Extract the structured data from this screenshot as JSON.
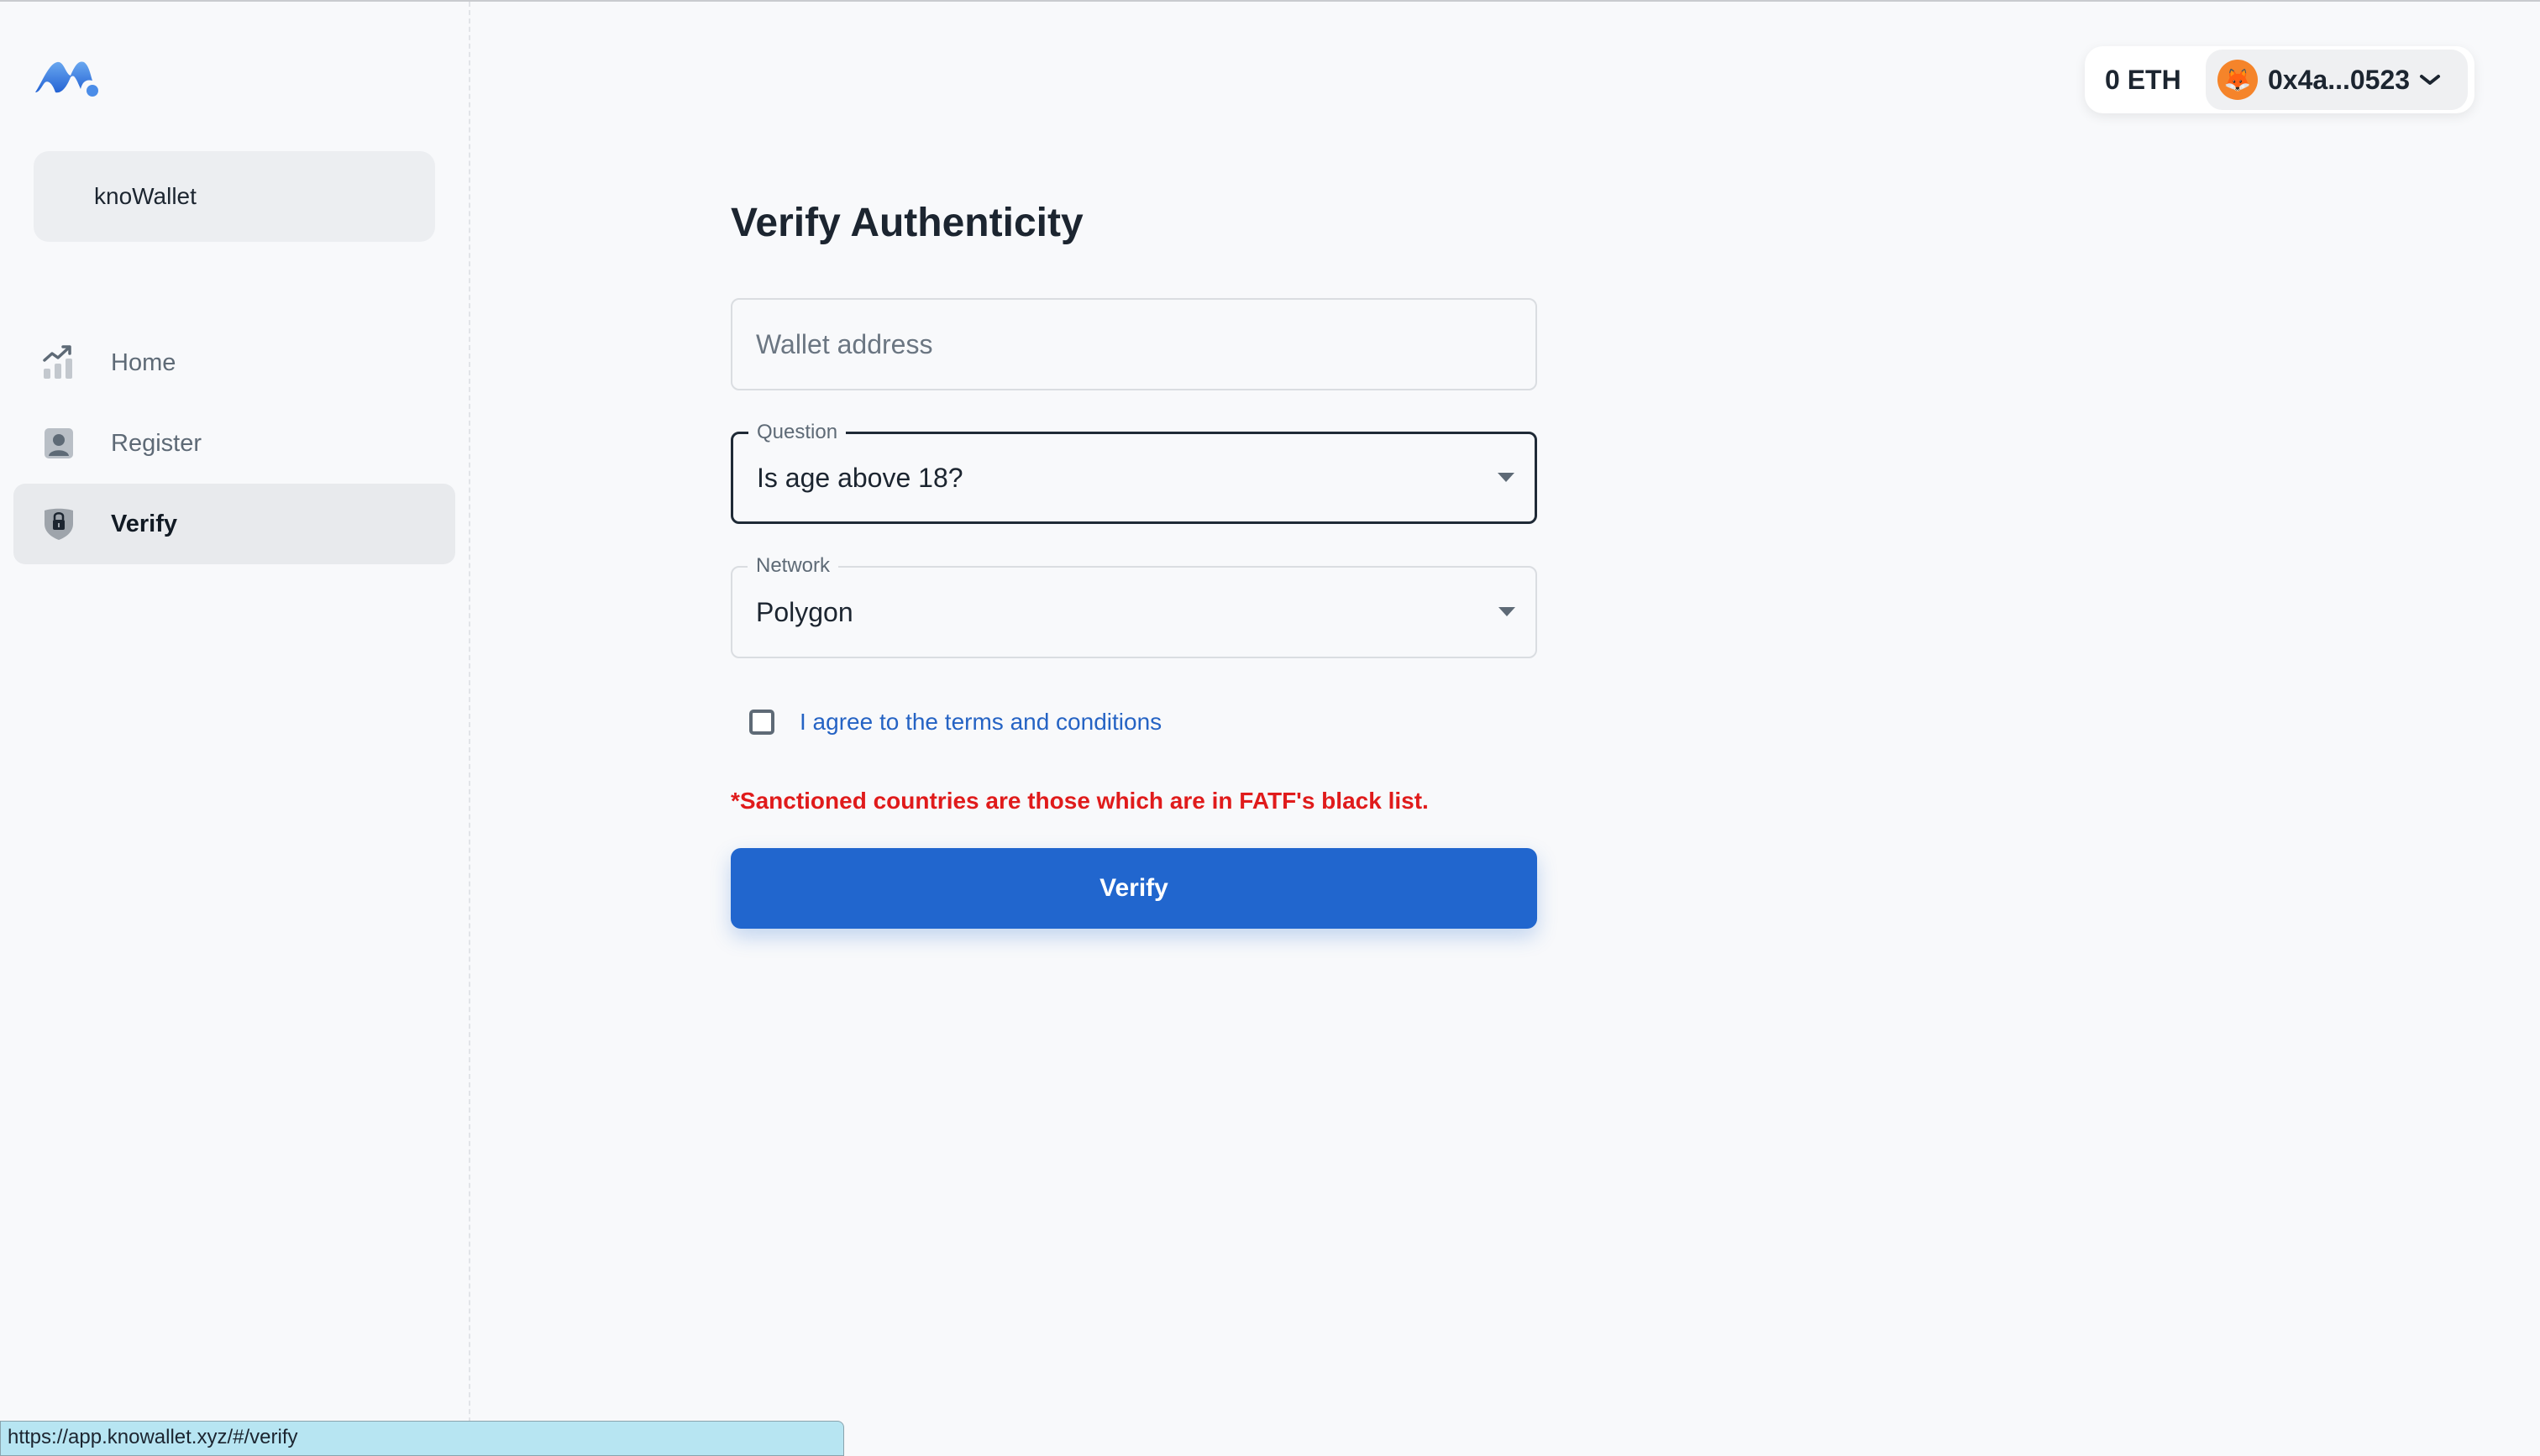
{
  "app": {
    "brand_name": "knoWallet",
    "logo_icon": "mountain-logo-icon"
  },
  "sidebar": {
    "items": [
      {
        "label": "Home",
        "icon": "chart-trend-icon",
        "active": false
      },
      {
        "label": "Register",
        "icon": "user-badge-icon",
        "active": false
      },
      {
        "label": "Verify",
        "icon": "shield-lock-icon",
        "active": true
      }
    ]
  },
  "header": {
    "balance": "0 ETH",
    "account_address": "0x4a...0523",
    "account_avatar": "🦊",
    "account_menu_icon": "chevron-down-icon"
  },
  "form": {
    "title": "Verify Authenticity",
    "wallet_address": {
      "placeholder": "Wallet address",
      "value": ""
    },
    "question": {
      "label": "Question",
      "selected": "Is age above 18?"
    },
    "network": {
      "label": "Network",
      "selected": "Polygon"
    },
    "agree": {
      "label": "I agree to the terms and conditions",
      "checked": false
    },
    "warning": "*Sanctioned countries are those which are in FATF's black list.",
    "submit_label": "Verify"
  },
  "colors": {
    "accent": "#2166ce",
    "warning": "#e01b1b",
    "link": "#2563c4",
    "background": "#f8f9fb"
  },
  "status_bar": {
    "url": "https://app.knowallet.xyz/#/verify"
  }
}
